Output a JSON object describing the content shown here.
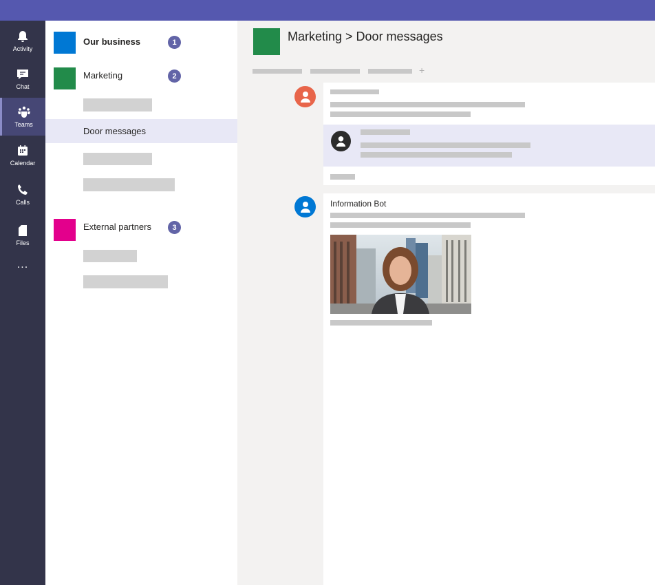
{
  "app": {
    "accent": "#5558af",
    "rail_bg": "#33344a"
  },
  "rail": {
    "items": [
      {
        "label": "Activity",
        "icon": "bell-icon"
      },
      {
        "label": "Chat",
        "icon": "chat-icon"
      },
      {
        "label": "Teams",
        "icon": "teams-icon",
        "active": true
      },
      {
        "label": "Calendar",
        "icon": "calendar-icon"
      },
      {
        "label": "Calls",
        "icon": "phone-icon"
      },
      {
        "label": "Files",
        "icon": "file-icon"
      }
    ],
    "more": "..."
  },
  "teams": [
    {
      "name": "Our business",
      "color": "#0078d4",
      "badge": "1",
      "bold": true
    },
    {
      "name": "Marketing",
      "color": "#228b4a",
      "badge": "2",
      "channels": [
        "Door messages"
      ],
      "selected_channel": "Door messages"
    },
    {
      "name": "External partners",
      "color": "#e3008c",
      "badge": "3"
    }
  ],
  "header": {
    "title": "Marketing > Door messages",
    "color": "#228b4a",
    "add_tab": "+"
  },
  "messages": [
    {
      "avatar_color": "#e8654a",
      "reply_avatar_color": "#2b2b2b"
    },
    {
      "author": "Information Bot",
      "avatar_color": "#0078d4",
      "image": "photo of a smiling woman on a city street"
    }
  ]
}
